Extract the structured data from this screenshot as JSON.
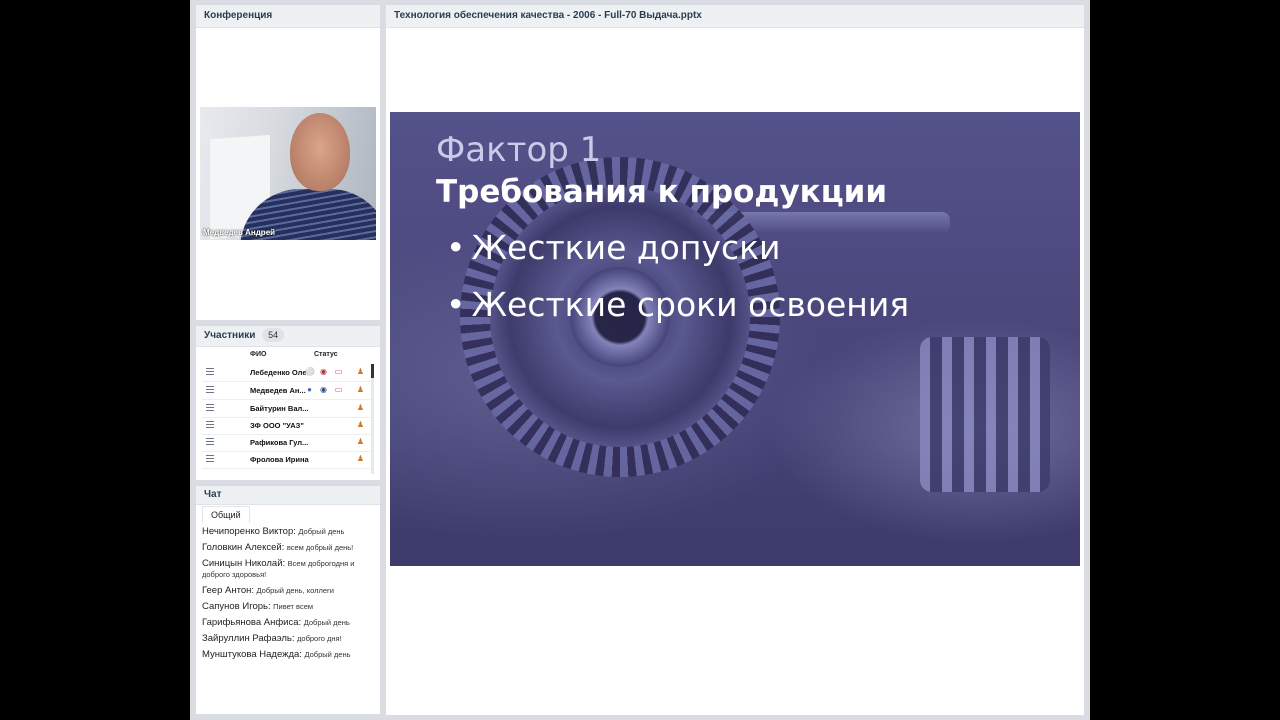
{
  "conference": {
    "title": "Конференция",
    "video_name": "Медведев Андрей"
  },
  "participants": {
    "title": "Участники",
    "count": "54",
    "col_name": "ФИО",
    "col_status": "Статус",
    "rows": [
      {
        "name": "Лебеденко Олег"
      },
      {
        "name": "Медведев Ан..."
      },
      {
        "name": "Байтурин Вал..."
      },
      {
        "name": "ЗФ ООО \"УАЗ\""
      },
      {
        "name": "Рафикова Гул..."
      },
      {
        "name": "Фролова  Ирина"
      }
    ]
  },
  "chat": {
    "title": "Чат",
    "tab": "Общий",
    "messages": [
      {
        "author": "Нечипоренко Виктор:",
        "text": "Добрый день"
      },
      {
        "author": "Головкин Алексей:",
        "text": "всем добрый день!"
      },
      {
        "author": "Синицын Николай:",
        "text": "Всем доброгодня и доброго здоровья!"
      },
      {
        "author": "Геер Антон:",
        "text": "Добрый день, коллеги"
      },
      {
        "author": "Сапунов Игорь:",
        "text": "Пивет всем"
      },
      {
        "author": "Гарифьянова Анфиса:",
        "text": "Добрый день"
      },
      {
        "author": "Зайруллин Рафаэль:",
        "text": "доброго дня!"
      },
      {
        "author": "Мунштукова  Надежда:",
        "text": "Добрый день"
      }
    ]
  },
  "presentation": {
    "title": "Технология обеспечения качества - 2006 - Full-70 Выдача.pptx",
    "slide": {
      "kicker": "Фактор 1",
      "heading": "Требования к продукции",
      "bullets": [
        "Жесткие допуски",
        "Жесткие сроки освоения"
      ]
    }
  }
}
